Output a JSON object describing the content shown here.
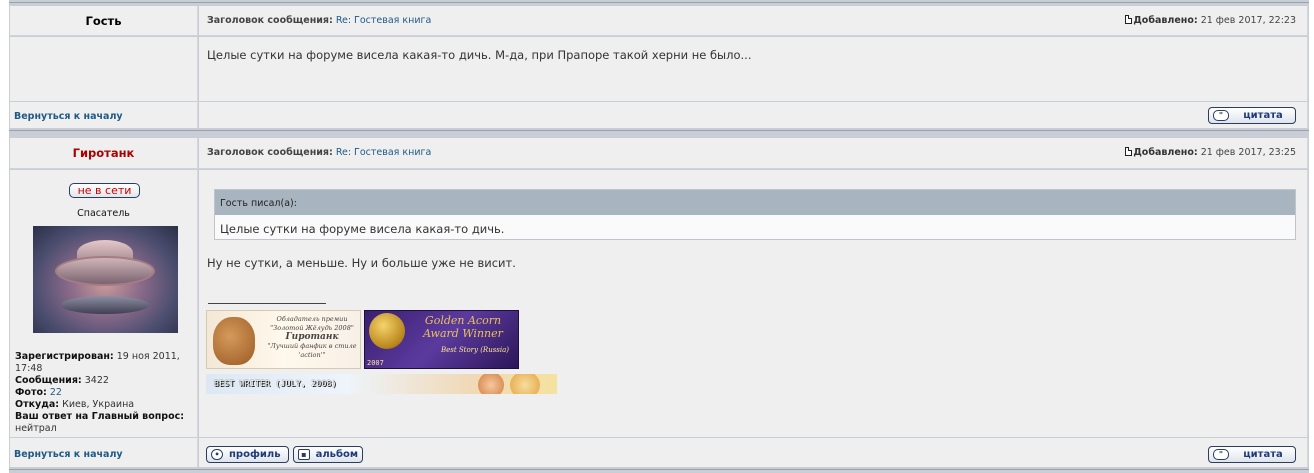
{
  "post1": {
    "author": "Гость",
    "subject_label": "Заголовок сообщения:",
    "subject": "Re: Гостевая книга",
    "added_label": "Добавлено:",
    "added_date": "21 фев 2017, 22:23",
    "text": "Целые сутки на форуме висела какая-то дичь. М-да, при Прапоре такой херни не было...",
    "back_link": "Вернуться к началу",
    "quote_button": "цитата"
  },
  "post2": {
    "author": "Гиротанк",
    "status": "не в сети",
    "rank": "Спасатель",
    "profile": {
      "registered_label": "Зарегистрирован:",
      "registered_value": "19 ноя 2011, 17:48",
      "posts_label": "Сообщения:",
      "posts_value": "3422",
      "photos_label": "Фото:",
      "photos_value": "22",
      "from_label": "Откуда:",
      "from_value": "Киев, Украина",
      "answer_label": "Ваш ответ на Главный вопрос:",
      "answer_value": "нейтрал"
    },
    "subject_label": "Заголовок сообщения:",
    "subject": "Re: Гостевая книга",
    "added_label": "Добавлено:",
    "added_date": "21 фев 2017, 23:25",
    "quote_header": "Гость писал(а):",
    "quote_text": "Целые сутки на форуме висела какая-то дичь.",
    "text": "Ну не сутки, а меньше. Ну и больше уже не висит.",
    "signature": {
      "banner1_line1": "Обладатель премии",
      "banner1_line2": "\"Золотой Жёлудь 2008\"",
      "banner1_name": "Гиротанк",
      "banner1_line3": "\"Лучший фанфик в стиле 'action'\"",
      "banner2_title": "Golden Acorn Award Winner",
      "banner2_sub": "Best Story (Russia)",
      "banner2_year": "2007",
      "banner3_text": "BEST WRITER (JULY, 2008)"
    },
    "back_link": "Вернуться к началу",
    "profile_button": "профиль",
    "album_button": "альбом",
    "quote_button": "цитата"
  }
}
